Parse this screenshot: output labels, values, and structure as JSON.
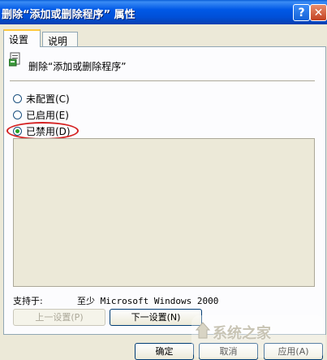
{
  "window": {
    "title": "删除“添加或删除程序” 属性",
    "help_label": "?",
    "close_label": "✕"
  },
  "tabs": [
    {
      "label": "设置",
      "active": true
    },
    {
      "label": "说明",
      "active": false
    }
  ],
  "policy": {
    "icon": "policy-document-icon",
    "title": "删除“添加或删除程序”"
  },
  "options": [
    {
      "label": "未配置(C)",
      "selected": false
    },
    {
      "label": "已启用(E)",
      "selected": false
    },
    {
      "label": "已禁用(D)",
      "selected": true
    }
  ],
  "support": {
    "label": "支持于:",
    "value": "至少 Microsoft Windows 2000"
  },
  "nav_buttons": {
    "prev": "上一设置(P)",
    "next": "下一设置(N)"
  },
  "dialog_buttons": {
    "ok": "确定",
    "cancel": "取消",
    "apply": "应用(A)"
  },
  "watermark": {
    "text": "系统之家"
  }
}
